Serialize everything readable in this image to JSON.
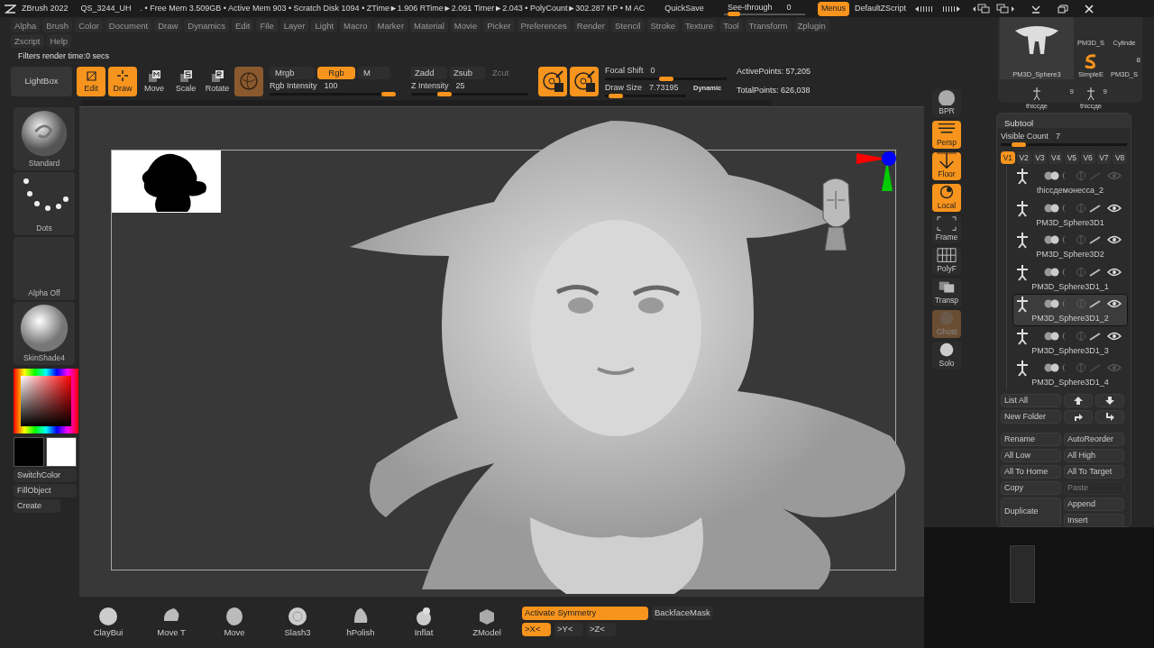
{
  "title_bar": {
    "app": "ZBrush 2022",
    "file": "QS_3244_UH",
    "stats": ". • Free Mem 3.509GB • Active Mem 903 • Scratch Disk 1094 •  ZTime►1.906 RTime►2.091 Timer►2.043 • PolyCount►302.287 KP  • M",
    "ac": "AC",
    "quicksave": "QuickSave",
    "see_through": {
      "label": "See-through",
      "value": "0",
      "level": 0.05
    },
    "menus": {
      "label": "Menus",
      "on": true
    },
    "script": "DefaultZScript"
  },
  "menu_rows": [
    [
      "Alpha",
      "Brush",
      "Color",
      "Document",
      "Draw",
      "Dynamics",
      "Edit",
      "File",
      "Layer",
      "Light",
      "Macro",
      "Marker",
      "Material",
      "Movie",
      "Picker",
      "Preferences",
      "Render",
      "Stencil",
      "Stroke",
      "Texture",
      "Tool",
      "Transform",
      "Zplugin"
    ],
    [
      "Zscript",
      "Help"
    ]
  ],
  "status_text": "Filters render time:0 secs",
  "toolbar": {
    "lightbox": "LightBox",
    "modes": [
      {
        "kind": "edit",
        "label": "Edit",
        "selected": true
      },
      {
        "kind": "draw",
        "label": "Draw",
        "selected": true
      },
      {
        "kind": "move",
        "label": "Move",
        "selected": false
      },
      {
        "kind": "scale",
        "label": "Scale",
        "selected": false
      },
      {
        "kind": "rotate",
        "label": "Rotate",
        "selected": false
      }
    ],
    "color_modes": [
      {
        "label": "Mrgb",
        "selected": false
      },
      {
        "label": "Rgb",
        "selected": true
      },
      {
        "label": "M",
        "selected": false
      }
    ],
    "rgb_intensity": {
      "label": "Rgb Intensity",
      "value": "100",
      "level": 1
    },
    "z_modes": [
      {
        "label": "Zadd",
        "disabled": false
      },
      {
        "label": "Zsub",
        "disabled": false
      },
      {
        "label": "Zcut",
        "disabled": true
      }
    ],
    "z_intensity": {
      "label": "Z Intensity",
      "value": "25",
      "level": 0.25
    },
    "focal_shift": {
      "label": "Focal Shift",
      "value": "0",
      "level": 0.5
    },
    "draw_size": {
      "label": "Draw Size",
      "value": "7.73195",
      "level": 0.05
    },
    "dynamic": "Dynamic",
    "active_points": "ActivePoints: 57,205",
    "total_points": "TotalPoints: 626,038"
  },
  "left_panel": {
    "brush": "Standard",
    "stroke": "Dots",
    "alpha": "Alpha Off",
    "material": "SkinShade4",
    "buttons": [
      "SwitchColor",
      "FillObject",
      "Create"
    ]
  },
  "right_tools": [
    {
      "label": "BPR",
      "on": false
    },
    {
      "label": "Persp",
      "on": true
    },
    {
      "label": "Floor",
      "on": true
    },
    {
      "label": "Local",
      "on": true
    },
    {
      "label": "Frame",
      "on": false
    },
    {
      "label": "PolyF",
      "on": false
    },
    {
      "label": "Transp",
      "on": false
    },
    {
      "label": "Ghost",
      "on": true
    },
    {
      "label": "Solo",
      "on": false
    }
  ],
  "tool_thumbnails": [
    {
      "label": "PM3D_Sphere3"
    },
    {
      "label": "PM3D_S"
    },
    {
      "label": "Cylinde"
    },
    {
      "label": "SimpleE"
    },
    {
      "label": "PM3D_S",
      "count": "8"
    },
    {
      "label": "thiccде",
      "count": "9"
    },
    {
      "label": "thiccде",
      "count": "9"
    }
  ],
  "subtool": {
    "title": "Subtool",
    "visible_count": {
      "label": "Visible Count",
      "value": "7",
      "level": 0.1
    },
    "versions": [
      {
        "label": "V1",
        "selected": true
      },
      {
        "label": "V2",
        "selected": false
      },
      {
        "label": "V3",
        "selected": false
      },
      {
        "label": "V4",
        "selected": false
      },
      {
        "label": "V5",
        "selected": false
      },
      {
        "label": "V6",
        "selected": false
      },
      {
        "label": "V7",
        "selected": false
      },
      {
        "label": "V8",
        "selected": false
      }
    ],
    "items": [
      {
        "name": "thiccдемонесса_2",
        "selected": false,
        "visible": false
      },
      {
        "name": "PM3D_Sphere3D1",
        "selected": false,
        "visible": true
      },
      {
        "name": "PM3D_Sphere3D2",
        "selected": false,
        "visible": true
      },
      {
        "name": "PM3D_Sphere3D1_1",
        "selected": false,
        "visible": true
      },
      {
        "name": "PM3D_Sphere3D1_2",
        "selected": true,
        "visible": true
      },
      {
        "name": "PM3D_Sphere3D1_3",
        "selected": false,
        "visible": true
      },
      {
        "name": "PM3D_Sphere3D1_4",
        "selected": false,
        "visible": false
      }
    ],
    "list_all": "List All",
    "new_folder": "New Folder",
    "actions": [
      {
        "label": "Rename",
        "disabled": false
      },
      {
        "label": "AutoReorder",
        "disabled": false
      },
      {
        "label": "All Low",
        "disabled": false
      },
      {
        "label": "All High",
        "disabled": false
      },
      {
        "label": "All To Home",
        "disabled": false
      },
      {
        "label": "All To Target",
        "disabled": false
      },
      {
        "label": "Copy",
        "disabled": false
      },
      {
        "label": "Paste",
        "disabled": true
      }
    ],
    "duplicate": "Duplicate",
    "append": "Append",
    "insert": "Insert"
  },
  "bottom_brushes": [
    "ClayBui",
    "Move T",
    "Move",
    "Slash3",
    "hPolish",
    "Inflat",
    "ZModel"
  ],
  "symmetry": {
    "activate": {
      "label": "Activate Symmetry",
      "on": true
    },
    "backface": {
      "label": "BackfaceMask",
      "on": false
    },
    "axes": [
      {
        "label": ">X<",
        "on": true
      },
      {
        "label": ">Y<",
        "on": false
      },
      {
        "label": ">Z<",
        "on": false
      }
    ]
  }
}
